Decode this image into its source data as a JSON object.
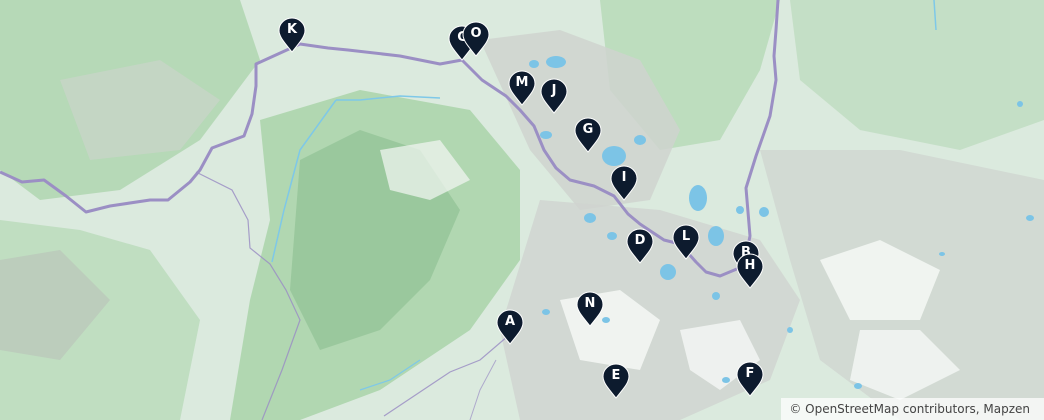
{
  "map": {
    "colors": {
      "forest": "#a9d3a9",
      "forest_dark": "#86bb8c",
      "meadow": "#dbeade",
      "rock": "#cfd3cf",
      "rock_dark": "#b8bcb8",
      "glacier": "#f3f6f3",
      "water": "#7cc4e6",
      "border": "#9b8fc4",
      "river": "#7ec8e8",
      "marker": "#0d1b2e"
    },
    "markers": [
      {
        "id": "K",
        "label": "K"
      },
      {
        "id": "C",
        "label": "C"
      },
      {
        "id": "O",
        "label": "O"
      },
      {
        "id": "M",
        "label": "M"
      },
      {
        "id": "J",
        "label": "J"
      },
      {
        "id": "G",
        "label": "G"
      },
      {
        "id": "I",
        "label": "I"
      },
      {
        "id": "D",
        "label": "D"
      },
      {
        "id": "L",
        "label": "L"
      },
      {
        "id": "B",
        "label": "B"
      },
      {
        "id": "H",
        "label": "H"
      },
      {
        "id": "A",
        "label": "A"
      },
      {
        "id": "N",
        "label": "N"
      },
      {
        "id": "E",
        "label": "E"
      },
      {
        "id": "F",
        "label": "F"
      }
    ],
    "attribution": "© OpenStreetMap contributors, Mapzen"
  }
}
